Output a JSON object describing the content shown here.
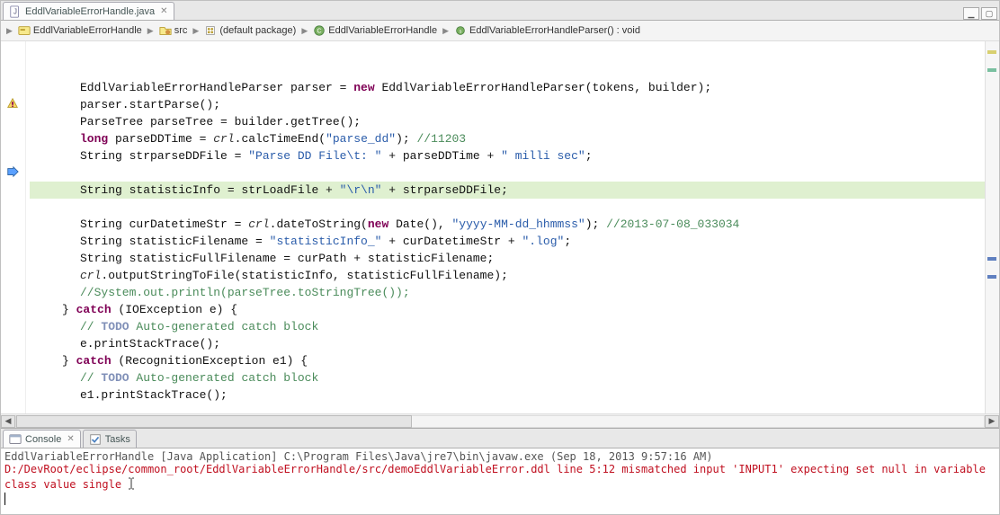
{
  "tab": {
    "label": "EddlVariableErrorHandle.java"
  },
  "breadcrumb": [
    {
      "icon": "package-root",
      "label": "EddlVariableErrorHandle"
    },
    {
      "icon": "source-folder",
      "label": "src"
    },
    {
      "icon": "package",
      "label": "(default package)"
    },
    {
      "icon": "class",
      "label": "EddlVariableErrorHandle"
    },
    {
      "icon": "method",
      "label": "EddlVariableErrorHandleParser() : void"
    }
  ],
  "code": {
    "l1a": "EddlVariableErrorHandleParser parser = ",
    "l1b": "new",
    "l1c": " EddlVariableErrorHandleParser(tokens, builder);",
    "l2": "parser.startParse();",
    "l3": "ParseTree parseTree = builder.getTree();",
    "l4a": "long",
    "l4b": " parseDDTime = ",
    "l4c": "crl",
    "l4d": ".calcTimeEnd(",
    "l4e": "\"parse_dd\"",
    "l4f": "); ",
    "l4g": "//11203",
    "l5a": "String strparseDDFile = ",
    "l5b": "\"Parse DD File\\t: \"",
    "l5c": " + parseDDTime + ",
    "l5d": "\" milli sec\"",
    "l5e": ";",
    "l7a": "String statisticInfo = strLoadFile + ",
    "l7b": "\"\\r\\n\"",
    "l7c": " + strparseDDFile;",
    "l8a": "String curDatetimeStr = ",
    "l8b": "crl",
    "l8c": ".dateToString(",
    "l8d": "new",
    "l8e": " Date(), ",
    "l8f": "\"yyyy-MM-dd_hhmmss\"",
    "l8g": "); ",
    "l8h": "//2013-07-08_033034",
    "l9a": "String statisticFilename = ",
    "l9b": "\"statisticInfo_\"",
    "l9c": " + curDatetimeStr + ",
    "l9d": "\".log\"",
    "l9e": ";",
    "l10": "String statisticFullFilename = curPath + statisticFilename;",
    "l11a": "crl",
    "l11b": ".outputStringToFile(statisticInfo, statisticFullFilename);",
    "l12": "//System.out.println(parseTree.toStringTree());",
    "l13a": "} ",
    "l13b": "catch",
    "l13c": " (IOException e) {",
    "l14a": "// ",
    "l14b": "TODO",
    "l14c": " Auto-generated catch block",
    "l15": "e.printStackTrace();",
    "l16a": "} ",
    "l16b": "catch",
    "l16c": " (RecognitionException e1) {",
    "l17a": "// ",
    "l17b": "TODO",
    "l17c": " Auto-generated catch block",
    "l18": "e1.printStackTrace();"
  },
  "console": {
    "tab1": "Console",
    "tab2": "Tasks",
    "header": "EddlVariableErrorHandle [Java Application] C:\\Program Files\\Java\\jre7\\bin\\javaw.exe (Sep 18, 2013 9:57:16 AM)",
    "error": "D:/DevRoot/eclipse/common_root/EddlVariableErrorHandle/src/demoEddlVariableError.ddl line 5:12 mismatched input 'INPUT1' expecting set null in variable class value single"
  }
}
